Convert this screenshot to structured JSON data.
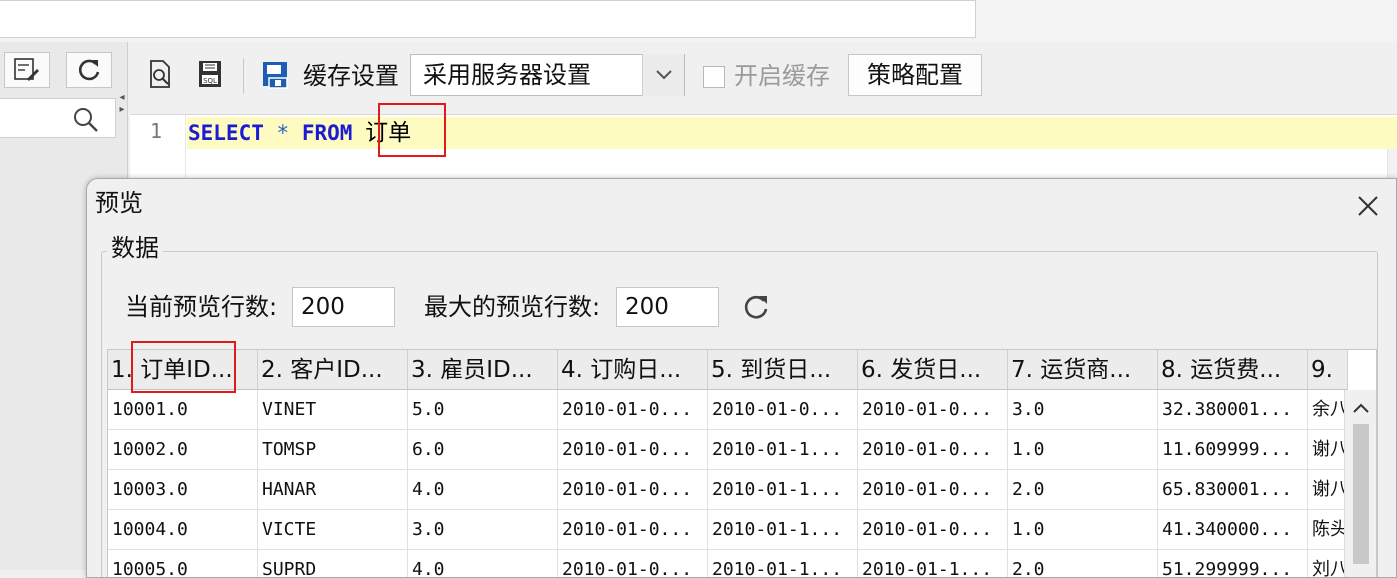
{
  "toolbar": {
    "cache_settings_label": "缓存设置",
    "cache_select_value": "采用服务器设置",
    "enable_cache_label": "开启缓存",
    "strategy_button_label": "策略配置"
  },
  "editor": {
    "line_number": "1",
    "sql_kw_select": "SELECT",
    "sql_star": "*",
    "sql_kw_from": "FROM",
    "sql_table": "订单"
  },
  "preview": {
    "title": "预览",
    "group_title": "数据",
    "current_rows_label": "当前预览行数:",
    "current_rows_value": "200",
    "max_rows_label": "最大的预览行数:",
    "max_rows_value": "200",
    "columns": [
      "1. 订单ID...",
      "2. 客户ID...",
      "3. 雇员ID...",
      "4. 订购日...",
      "5. 到货日...",
      "6. 发货日...",
      "7. 运货商...",
      "8. 运货费...",
      "9."
    ],
    "rows": [
      [
        "10001.0",
        "VINET",
        "5.0",
        "2010-01-0...",
        "2010-01-0...",
        "2010-01-0...",
        "3.0",
        "32.380001...",
        "余八"
      ],
      [
        "10002.0",
        "TOMSP",
        "6.0",
        "2010-01-0...",
        "2010-01-1...",
        "2010-01-0...",
        "1.0",
        "11.609999...",
        "谢八"
      ],
      [
        "10003.0",
        "HANAR",
        "4.0",
        "2010-01-0...",
        "2010-01-1...",
        "2010-01-0...",
        "2.0",
        "65.830001...",
        "谢八"
      ],
      [
        "10004.0",
        "VICTE",
        "3.0",
        "2010-01-0...",
        "2010-01-1...",
        "2010-01-0...",
        "1.0",
        "41.340000...",
        "陈头"
      ],
      [
        "10005.0",
        "SUPRD",
        "4.0",
        "2010-01-0...",
        "2010-01-1...",
        "2010-01-1...",
        "2.0",
        "51.299999...",
        "刘八"
      ]
    ]
  },
  "colors": {
    "highlight_box": "#e11b1b",
    "sql_keyword": "#1b1bd6",
    "line_highlight": "#fdfbbf"
  }
}
